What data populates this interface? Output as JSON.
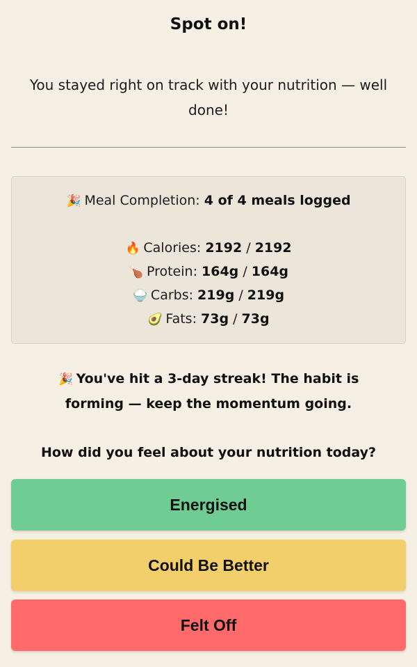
{
  "header": {
    "title": "Spot on!",
    "message": "You stayed right on track with your nutrition — well done!"
  },
  "summary": {
    "meal": {
      "icon": "🎉",
      "label": "Meal Completion: ",
      "value": "4 of 4 meals logged"
    },
    "calories": {
      "icon": "🔥",
      "label": "Calories: ",
      "actual": "2192",
      "separator": " / ",
      "target": "2192"
    },
    "protein": {
      "icon": "🍗",
      "label": "Protein: ",
      "actual": "164g",
      "separator": " / ",
      "target": "164g"
    },
    "carbs": {
      "icon": "🍚",
      "label": "Carbs: ",
      "actual": "219g",
      "separator": " / ",
      "target": "219g"
    },
    "fats": {
      "icon": "🥑",
      "label": "Fats: ",
      "actual": "73g",
      "separator": " / ",
      "target": "73g"
    }
  },
  "streak": {
    "icon": "🎉",
    "text": "You've hit a 3-day streak! The habit is forming — keep the momentum going."
  },
  "feedback": {
    "question": "How did you feel about your nutrition today?",
    "options": [
      {
        "label": "Energised",
        "color": "#6fcd94"
      },
      {
        "label": "Could Be Better",
        "color": "#f2cf6a"
      },
      {
        "label": "Felt Off",
        "color": "#ff6b6b"
      }
    ]
  },
  "colors": {
    "background": "#f6efe4",
    "card": "#ece6da"
  }
}
